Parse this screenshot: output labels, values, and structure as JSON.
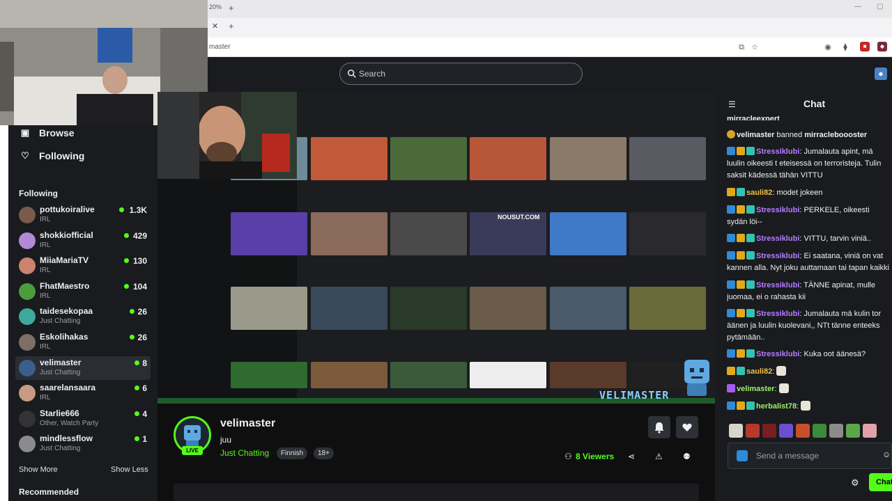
{
  "browser": {
    "zoom": "20%",
    "address": "master"
  },
  "search": {
    "placeholder": "Search"
  },
  "nav": {
    "browse": "Browse",
    "following": "Following"
  },
  "following_title": "Following",
  "channels": [
    {
      "name": "pottukoiralive",
      "category": "IRL",
      "viewers": "1.3K",
      "color": "#7a5a4a"
    },
    {
      "name": "shokkiofficial",
      "category": "IRL",
      "viewers": "429",
      "color": "#b08ad6"
    },
    {
      "name": "MiiaMariaTV",
      "category": "IRL",
      "viewers": "130",
      "color": "#c9836f"
    },
    {
      "name": "FhatMaestro",
      "category": "IRL",
      "viewers": "104",
      "color": "#4a9d3b"
    },
    {
      "name": "taidesekopaa",
      "category": "Just Chatting",
      "viewers": "26",
      "color": "#3ea89c"
    },
    {
      "name": "Eskolihakas",
      "category": "IRL",
      "viewers": "26",
      "color": "#7d6f66"
    },
    {
      "name": "velimaster",
      "category": "Just Chatting",
      "viewers": "8",
      "color": "#3a5f8a",
      "active": true
    },
    {
      "name": "saarelansaara",
      "category": "IRL",
      "viewers": "6",
      "color": "#c69a85"
    },
    {
      "name": "Starlie666",
      "category": "Other, Watch Party",
      "viewers": "4",
      "color": "#333333"
    },
    {
      "name": "mindlessflow",
      "category": "Just Chatting",
      "viewers": "1",
      "color": "#8b8b8b"
    }
  ],
  "show_more": "Show More",
  "show_less": "Show Less",
  "recommended": "Recommended",
  "stream": {
    "streamer": "velimaster",
    "live": "LIVE",
    "title": "juu",
    "category": "Just Chatting",
    "tags": [
      "Finnish",
      "18+"
    ],
    "viewers": "8",
    "viewers_label": "Viewers",
    "overlay_brand": "VELIMASTER",
    "overlay_thumb_title": "NOUSUT.COM"
  },
  "chat": {
    "title": "Chat",
    "messages": [
      {
        "user": "velimaster",
        "text": "banned",
        "target": "mirracleexpert",
        "type": "ban",
        "partial": true
      },
      {
        "user": "velimaster",
        "text": "banned",
        "target": "mirracleboooster",
        "type": "ban"
      },
      {
        "user": "Stressiklubi",
        "text": "Jumalauta apint, mä luulin oikeesti t eteisessä on terroristeja. Tulin saksit kädessä tähän VITTU"
      },
      {
        "user": "sauli82",
        "text": "modet jokeen"
      },
      {
        "user": "Stressiklubi",
        "text": "PERKELE, oikeesti sydän löi--"
      },
      {
        "user": "Stressiklubi",
        "text": "VITTU, tarvin viniä.."
      },
      {
        "user": "Stressiklubi",
        "text": "Ei saatana, viniä on vat kannen alla. Nyt joku auttamaan tai tapan kaikki"
      },
      {
        "user": "Stressiklubi",
        "text": "TÄNNE apinat, mulle juomaa, ei o rahasta kii"
      },
      {
        "user": "Stressiklubi",
        "text": "Jumalauta mä kulin tor äänen ja luulin kuolevani,, NTt tänne enteeks pytämään.."
      },
      {
        "user": "Stressiklubi",
        "text": "Kuka oot äänesä?"
      },
      {
        "user": "sauli82",
        "text": ""
      },
      {
        "user": "velimaster",
        "text": ""
      },
      {
        "user": "herbalist78",
        "text": ""
      }
    ],
    "input_placeholder": "Send a message",
    "send_label": "Chat"
  },
  "colors": {
    "accent": "#53fc18",
    "background": "#0f0f10",
    "panel": "#191b1f"
  }
}
